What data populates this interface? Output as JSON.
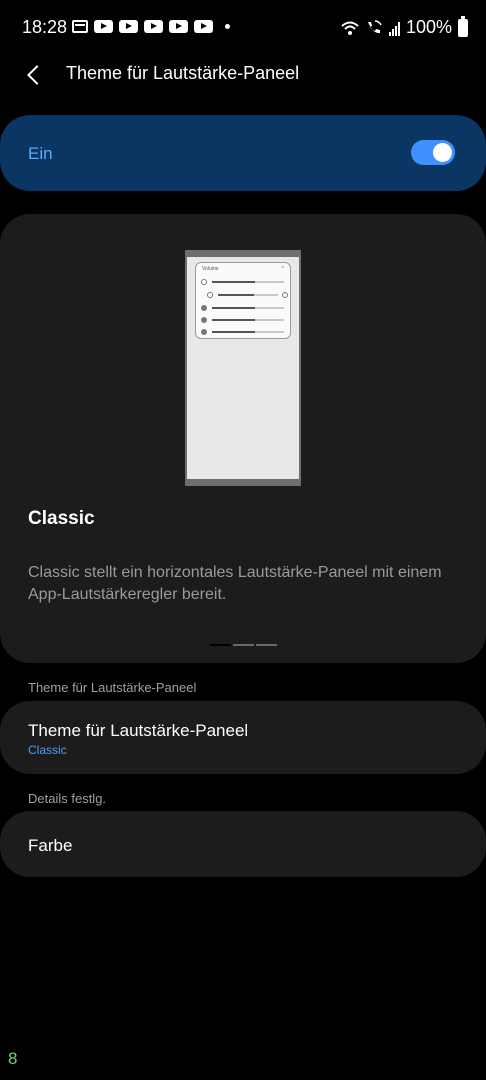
{
  "status_bar": {
    "time": "18:28",
    "notification_icons": [
      "calendar-icon",
      "youtube-icon",
      "youtube-icon",
      "youtube-icon",
      "youtube-icon",
      "youtube-icon"
    ],
    "battery": "100%"
  },
  "header": {
    "title": "Theme für Lautstärke-Paneel"
  },
  "master_toggle": {
    "label": "Ein",
    "on": true,
    "accent": "#3e91ff"
  },
  "preview": {
    "mock_title": "Volume",
    "name": "Classic",
    "description": "Classic stellt ein horizontales Lautstärke-Paneel mit einem App-Lautstärkeregler bereit.",
    "page_count": 3,
    "active_page": 0
  },
  "section_theme": {
    "label": "Theme für Lautstärke-Paneel",
    "item_title": "Theme für Lautstärke-Paneel",
    "item_value": "Classic"
  },
  "section_details": {
    "label": "Details festlg.",
    "item_title": "Farbe"
  },
  "corner_digit": "8",
  "colors": {
    "background": "#000000",
    "card": "#1c1c1c",
    "toggle_card": "#0b3563",
    "accent_text": "#4d9aff"
  }
}
